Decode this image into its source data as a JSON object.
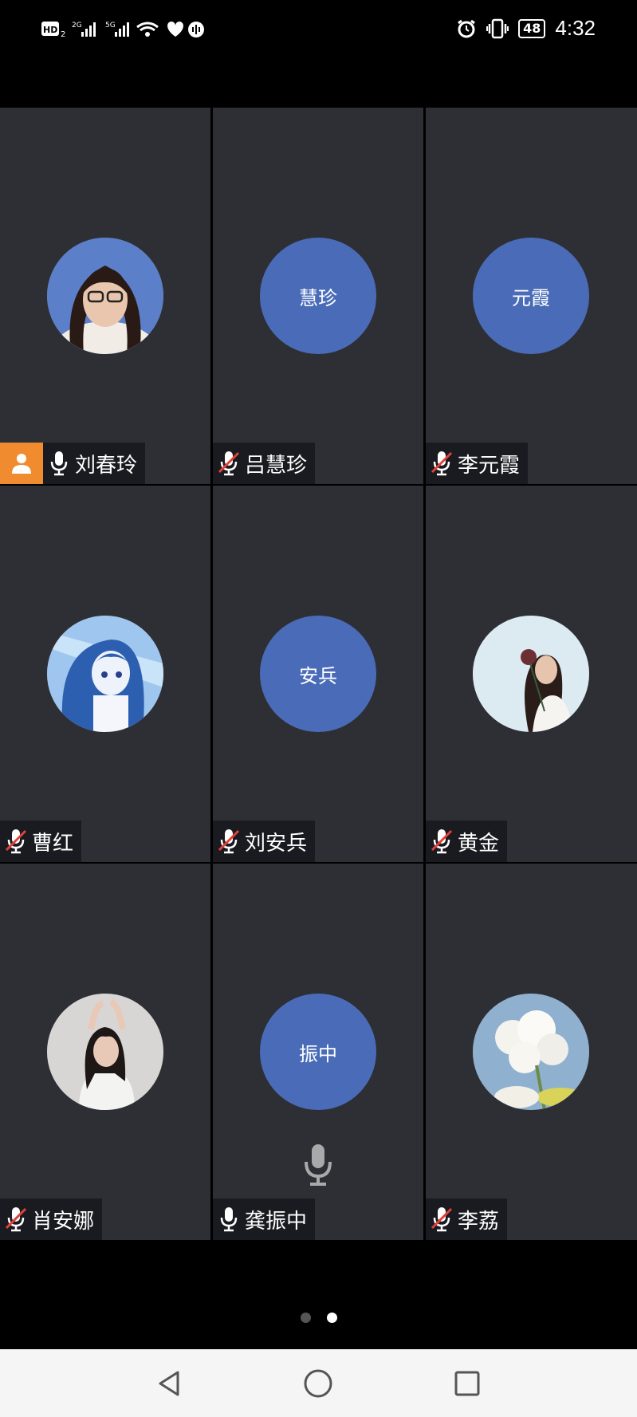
{
  "status_bar": {
    "left_text": "HD₂ ⁵ᴳ",
    "battery": "48",
    "time": "4:32"
  },
  "participants": [
    {
      "name": "刘春玲",
      "avatar_type": "photo",
      "initials": "",
      "mic": "on",
      "host": true
    },
    {
      "name": "吕慧珍",
      "avatar_type": "initials",
      "initials": "慧珍",
      "mic": "muted",
      "host": false
    },
    {
      "name": "李元霞",
      "avatar_type": "initials",
      "initials": "元霞",
      "mic": "muted",
      "host": false
    },
    {
      "name": "曹红",
      "avatar_type": "photo",
      "initials": "",
      "mic": "muted",
      "host": false
    },
    {
      "name": "刘安兵",
      "avatar_type": "initials",
      "initials": "安兵",
      "mic": "muted",
      "host": false
    },
    {
      "name": "黄金",
      "avatar_type": "photo",
      "initials": "",
      "mic": "muted",
      "host": false
    },
    {
      "name": "肖安娜",
      "avatar_type": "photo",
      "initials": "",
      "mic": "muted",
      "host": false
    },
    {
      "name": "龚振中",
      "avatar_type": "initials",
      "initials": "振中",
      "mic": "on",
      "host": false,
      "speaking": true
    },
    {
      "name": "李荔",
      "avatar_type": "photo",
      "initials": "",
      "mic": "muted",
      "host": false
    }
  ],
  "pager": {
    "pages": 2,
    "current": 2
  },
  "colors": {
    "tile_bg": "#2e2f35",
    "avatar_initials_bg": "#4a6cb8",
    "host_badge": "#f08c2f",
    "muted_slash": "#e0413a"
  },
  "icons": {
    "host": "person-icon",
    "mic_on": "microphone-icon",
    "mic_muted": "microphone-muted-icon",
    "nav_back": "back-triangle-icon",
    "nav_home": "home-circle-icon",
    "nav_recent": "recents-square-icon"
  }
}
